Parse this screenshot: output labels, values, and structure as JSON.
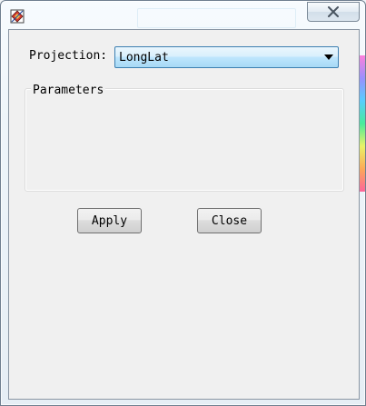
{
  "window": {
    "icons": {
      "app": "app-logo-icon",
      "close": "close-x-icon"
    }
  },
  "projection": {
    "label": "Projection:",
    "selected": "LongLat",
    "arrow_icon": "dropdown-arrow-icon"
  },
  "parameters": {
    "title": "Parameters"
  },
  "buttons": {
    "apply": "Apply",
    "close": "Close"
  },
  "colors": {
    "select_border": "#3c7fb1",
    "select_fill": "#bee6fd",
    "client_bg": "#f0f0f0"
  }
}
